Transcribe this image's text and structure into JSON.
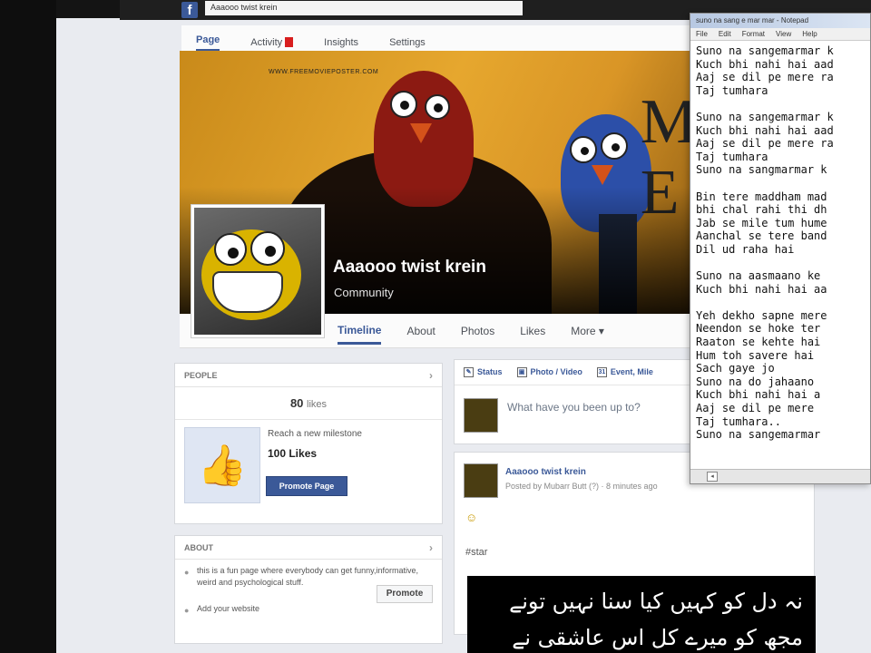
{
  "browser": {
    "search_text": "Aaaooo twist krein"
  },
  "page_nav": {
    "page": "Page",
    "activity": "Activity",
    "insights": "Insights",
    "settings": "Settings"
  },
  "cover": {
    "watermark": "WWW.FREEMOVIEPOSTER.COM",
    "big_text": "M\nE"
  },
  "page": {
    "name": "Aaaooo twist krein",
    "category": "Community"
  },
  "tabs": {
    "timeline": "Timeline",
    "about": "About",
    "photos": "Photos",
    "likes": "Likes",
    "more": "More ▾"
  },
  "people": {
    "header": "PEOPLE",
    "likes_count": "80",
    "likes_label": "likes",
    "milestone_text": "Reach a new milestone",
    "milestone_title": "100 Likes",
    "promote_page": "Promote Page"
  },
  "about": {
    "header": "ABOUT",
    "description": "this is a fun page where everybody can get funny,informative, weird and psychological stuff.",
    "add_website": "Add your website",
    "promote": "Promote"
  },
  "composer": {
    "status": "Status",
    "photo_video": "Photo / Video",
    "event": "Event, Mile",
    "placeholder": "What have you been up to?"
  },
  "post": {
    "author": "Aaaooo twist krein",
    "meta": "Posted by Mubarr Butt (?) · 8 minutes ago",
    "emoji": "☺",
    "hashtag": "#star",
    "urdu_text": "نہ دل کو کہیں کیا سنا نہیں تونے ‏ مجھ کو میرے کل اس عاشقی نے حال کیا"
  },
  "notepad": {
    "title": "suno na sang e mar mar - Notepad",
    "menu": {
      "file": "File",
      "edit": "Edit",
      "format": "Format",
      "view": "View",
      "help": "Help"
    },
    "lyrics": "Suno na sangemarmar k\nKuch bhi nahi hai aad\nAaj se dil pe mere ra\nTaj tumhara\n\nSuno na sangemarmar k\nKuch bhi nahi hai aad\nAaj se dil pe mere ra\nTaj tumhara\nSuno na sangmarmar k\n\nBin tere maddham mad\nbhi chal rahi thi dh\nJab se mile tum hume\nAanchal se tere band\nDil ud raha hai\n\nSuno na aasmaano ke\nKuch bhi nahi hai aa\n\nYeh dekho sapne mere\nNeendon se hoke ter\nRaaton se kehte hai\nHum toh savere hai\nSach gaye jo\nSuno na do jahaano\nKuch bhi nahi hai a\nAaj se dil pe mere\nTaj tumhara..\nSuno na sangemarmar"
  },
  "colors": {
    "facebook_blue": "#3b5998",
    "activity_red": "#d81e1e",
    "cover_orange": "#e6a72e"
  }
}
